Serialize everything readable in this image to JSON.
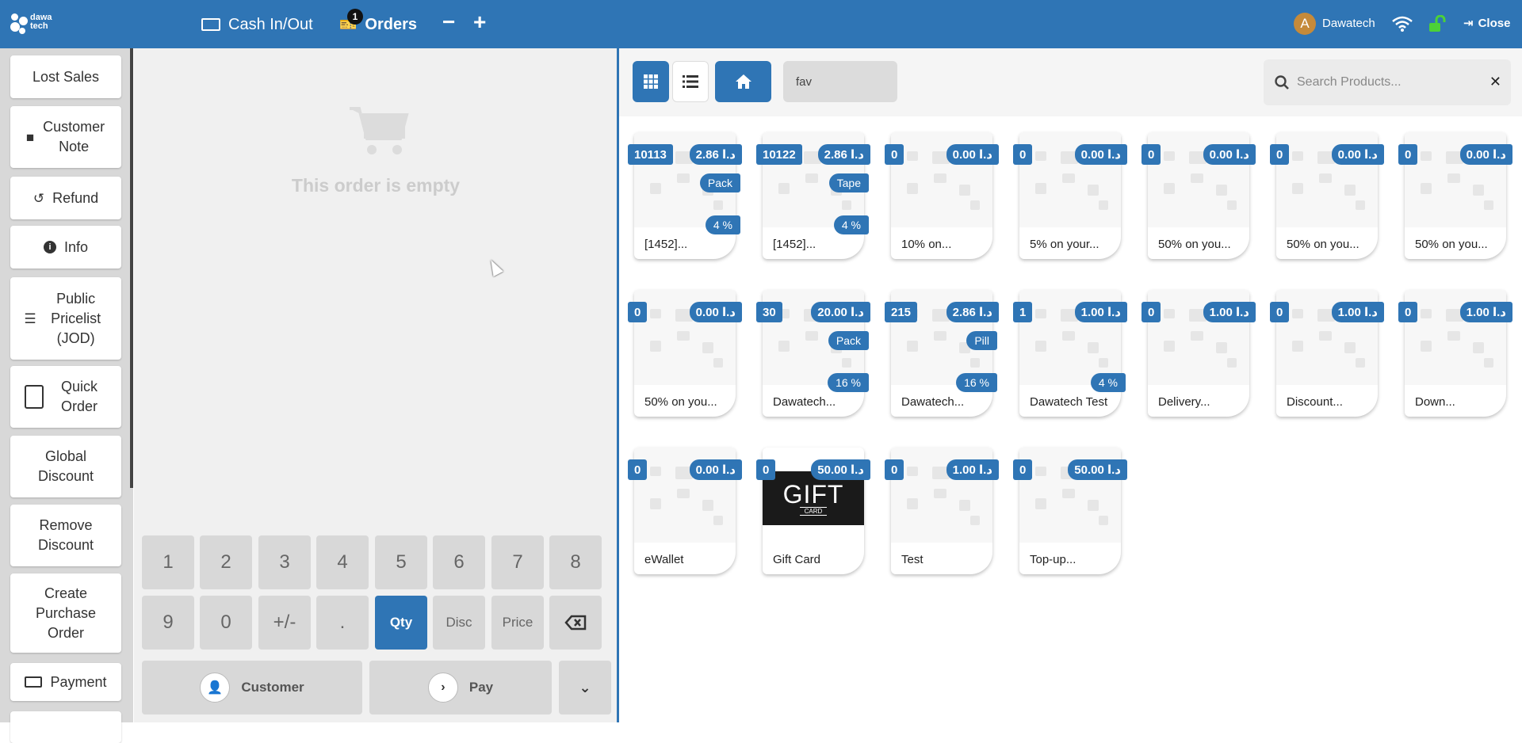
{
  "header": {
    "logo_text": "dawa tech",
    "cash_label": "Cash In/Out",
    "orders_label": "Orders",
    "orders_count": "1",
    "minus": "−",
    "plus": "+",
    "avatar_letter": "A",
    "user_name": "Dawatech",
    "close_label": "Close"
  },
  "sidebar": {
    "items": [
      {
        "label": "Lost Sales",
        "icon": ""
      },
      {
        "label": "Customer Note",
        "icon": "note-icon"
      },
      {
        "label": "Refund",
        "icon": "undo-icon"
      },
      {
        "label": "Info",
        "icon": "info-icon"
      },
      {
        "label": "Public Pricelist (JOD)",
        "icon": "list-icon"
      },
      {
        "label": "Quick Order",
        "icon": "order-icon"
      },
      {
        "label": "Global Discount",
        "icon": ""
      },
      {
        "label": "Remove Discount",
        "icon": ""
      },
      {
        "label": "Create Purchase Order",
        "icon": ""
      },
      {
        "label": "Payment",
        "icon": "money-icon"
      }
    ]
  },
  "order": {
    "empty_text": "This order is empty"
  },
  "numpad": {
    "keys": [
      "1",
      "2",
      "3",
      "4",
      "5",
      "6",
      "7",
      "8",
      "9",
      "0",
      "+/-",
      ".",
      "Qty",
      "Disc",
      "Price"
    ],
    "selected": "Qty",
    "customer_label": "Customer",
    "pay_label": "Pay"
  },
  "toolbar": {
    "fav_label": "fav",
    "search_placeholder": "Search Products...",
    "accent": "#2f75b5"
  },
  "currency": "د.ا",
  "products": [
    {
      "qty": "10113",
      "price": "2.86",
      "unit": "Pack",
      "tax": "4 %",
      "name": "[1452]..."
    },
    {
      "qty": "10122",
      "price": "2.86",
      "unit": "Tape",
      "tax": "4 %",
      "name": "[1452]..."
    },
    {
      "qty": "0",
      "price": "0.00",
      "unit": "",
      "tax": "",
      "name": "10% on..."
    },
    {
      "qty": "0",
      "price": "0.00",
      "unit": "",
      "tax": "",
      "name": "5% on your..."
    },
    {
      "qty": "0",
      "price": "0.00",
      "unit": "",
      "tax": "",
      "name": "50% on you..."
    },
    {
      "qty": "0",
      "price": "0.00",
      "unit": "",
      "tax": "",
      "name": "50% on you..."
    },
    {
      "qty": "0",
      "price": "0.00",
      "unit": "",
      "tax": "",
      "name": "50% on you..."
    },
    {
      "qty": "0",
      "price": "0.00",
      "unit": "",
      "tax": "",
      "name": "50% on you..."
    },
    {
      "qty": "30",
      "price": "20.00",
      "unit": "Pack",
      "tax": "16 %",
      "name": "Dawatech..."
    },
    {
      "qty": "215",
      "price": "2.86",
      "unit": "Pill",
      "tax": "16 %",
      "name": "Dawatech..."
    },
    {
      "qty": "1",
      "price": "1.00",
      "unit": "",
      "tax": "4 %",
      "name": "Dawatech Test"
    },
    {
      "qty": "0",
      "price": "1.00",
      "unit": "",
      "tax": "",
      "name": "Delivery..."
    },
    {
      "qty": "0",
      "price": "1.00",
      "unit": "",
      "tax": "",
      "name": "Discount..."
    },
    {
      "qty": "0",
      "price": "1.00",
      "unit": "",
      "tax": "",
      "name": "Down..."
    },
    {
      "qty": "0",
      "price": "0.00",
      "unit": "",
      "tax": "",
      "name": "eWallet"
    },
    {
      "qty": "0",
      "price": "50.00",
      "unit": "",
      "tax": "",
      "name": "Gift Card",
      "gift": true,
      "gift_title": "GIFT",
      "gift_sub": "CARD"
    },
    {
      "qty": "0",
      "price": "1.00",
      "unit": "",
      "tax": "",
      "name": "Test"
    },
    {
      "qty": "0",
      "price": "50.00",
      "unit": "",
      "tax": "",
      "name": "Top-up..."
    }
  ]
}
